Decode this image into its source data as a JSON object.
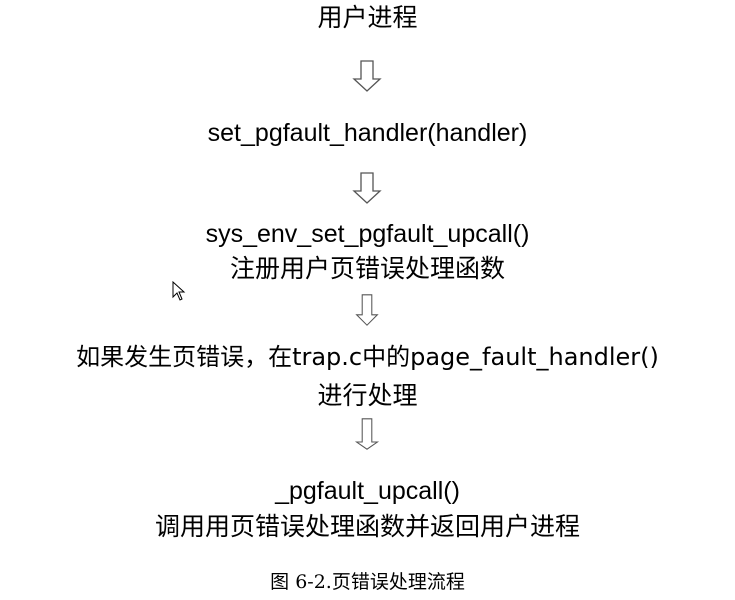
{
  "steps": [
    {
      "lines": [
        "用户进程"
      ]
    },
    {
      "lines": [
        "set_pgfault_handler(handler)"
      ]
    },
    {
      "lines": [
        "sys_env_set_pgfault_upcall()",
        "注册用户页错误处理函数"
      ]
    },
    {
      "lines": [
        "如果发生页错误，在trap.c中的page_fault_handler()",
        "进行处理"
      ]
    },
    {
      "lines": [
        "_pgfault_upcall()",
        "调用用页错误处理函数并返回用户进程"
      ]
    }
  ],
  "caption": "图 6-2.页错误处理流程",
  "colors": {
    "text": "#000000",
    "arrow_stroke": "#555555",
    "arrow_fill": "#ffffff"
  },
  "icons": {
    "arrow": "hollow-down-arrow-icon",
    "cursor": "mouse-pointer-icon"
  }
}
